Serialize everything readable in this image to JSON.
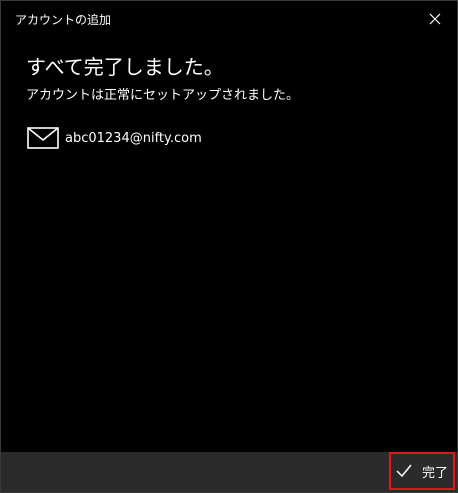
{
  "window": {
    "title": "アカウントの追加",
    "close_icon": "close-icon"
  },
  "main": {
    "heading": "すべて完了しました。",
    "subtext": "アカウントは正常にセットアップされました。"
  },
  "account": {
    "icon": "mail-icon",
    "email": "abc01234@nifty.com"
  },
  "footer": {
    "done_label": "完了",
    "done_icon": "checkmark-icon"
  },
  "colors": {
    "background": "#000000",
    "footer": "#2b2b2b",
    "highlight": "#e0141c"
  }
}
